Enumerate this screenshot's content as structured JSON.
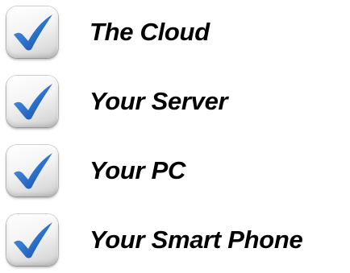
{
  "colors": {
    "check": "#2a6fc9",
    "check_dark": "#15468f",
    "text": "#000000",
    "box_light": "#ffffff",
    "box_dark": "#c9c9c9"
  },
  "items": [
    {
      "label": "The Cloud",
      "checked": true,
      "icon": "checkmark-icon"
    },
    {
      "label": "Your Server",
      "checked": true,
      "icon": "checkmark-icon"
    },
    {
      "label": "Your PC",
      "checked": true,
      "icon": "checkmark-icon"
    },
    {
      "label": "Your Smart Phone",
      "checked": true,
      "icon": "checkmark-icon"
    }
  ]
}
